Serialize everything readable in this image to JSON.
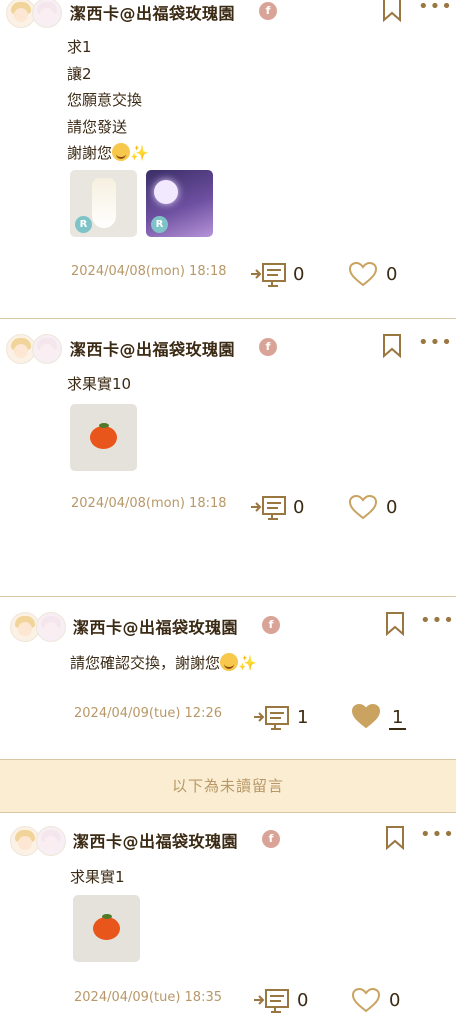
{
  "posts": [
    {
      "username": "潔西卡@出福袋玫瑰園",
      "badge": "f",
      "lines": [
        "求1",
        "讓2",
        "您願意交換",
        "請您發送",
        "謝謝您"
      ],
      "images": [
        {
          "icon": "wedding-dress-item",
          "badge": "R"
        },
        {
          "icon": "moon-night-item",
          "badge": "R"
        }
      ],
      "date": "2024/04/08(mon) 18:18",
      "comments": "0",
      "likes": "0"
    },
    {
      "username": "潔西卡@出福袋玫瑰園",
      "badge": "f",
      "lines": [
        "求果實10"
      ],
      "images": [
        {
          "icon": "persimmon-item"
        }
      ],
      "date": "2024/04/08(mon) 18:18",
      "comments": "0",
      "likes": "0"
    },
    {
      "username": "潔西卡@出福袋玫瑰園",
      "badge": "f",
      "lines": [
        "請您確認交換，謝謝您"
      ],
      "date": "2024/04/09(tue) 12:26",
      "comments": "1",
      "likes": "1",
      "liked": true
    },
    {
      "username": "潔西卡@出福袋玫瑰園",
      "badge": "f",
      "lines": [
        "求果實1"
      ],
      "images": [
        {
          "icon": "persimmon-item"
        }
      ],
      "date": "2024/04/09(tue) 18:35",
      "comments": "0",
      "likes": "0"
    }
  ],
  "unread_divider": "以下為未讀留言",
  "colors": {
    "accent": "#c9a35f",
    "text": "#3b2a14",
    "date": "#b89868",
    "badge": "#d9a497",
    "unread_bg": "#fbedd2",
    "liked_heart": "#c9a35f"
  }
}
